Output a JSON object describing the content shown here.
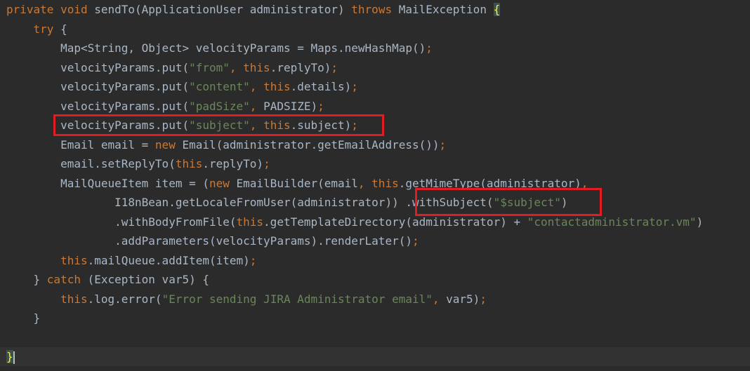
{
  "code": {
    "lines": [
      [
        {
          "t": "private void ",
          "c": "kw"
        },
        {
          "t": "sendTo(ApplicationUser administrator) ",
          "c": "plain"
        },
        {
          "t": "throws ",
          "c": "kw"
        },
        {
          "t": "MailException ",
          "c": "plain"
        },
        {
          "t": "{",
          "c": "brace-match"
        }
      ],
      [
        {
          "t": "    try ",
          "c": "kw"
        },
        {
          "t": "{",
          "c": "plain"
        }
      ],
      [
        {
          "t": "        Map<String, Object> velocityParams = Maps.newHashMap()",
          "c": "plain"
        },
        {
          "t": ";",
          "c": "kw"
        }
      ],
      [
        {
          "t": "        velocityParams.put(",
          "c": "plain"
        },
        {
          "t": "\"from\"",
          "c": "str"
        },
        {
          "t": ", ",
          "c": "kw"
        },
        {
          "t": "this",
          "c": "kw"
        },
        {
          "t": ".replyTo)",
          "c": "plain"
        },
        {
          "t": ";",
          "c": "kw"
        }
      ],
      [
        {
          "t": "        velocityParams.put(",
          "c": "plain"
        },
        {
          "t": "\"content\"",
          "c": "str"
        },
        {
          "t": ", ",
          "c": "kw"
        },
        {
          "t": "this",
          "c": "kw"
        },
        {
          "t": ".details)",
          "c": "plain"
        },
        {
          "t": ";",
          "c": "kw"
        }
      ],
      [
        {
          "t": "        velocityParams.put(",
          "c": "plain"
        },
        {
          "t": "\"padSize\"",
          "c": "str"
        },
        {
          "t": ", ",
          "c": "kw"
        },
        {
          "t": "PADSIZE)",
          "c": "plain"
        },
        {
          "t": ";",
          "c": "kw"
        }
      ],
      [
        {
          "t": "        velocityParams.put(",
          "c": "plain"
        },
        {
          "t": "\"subject\"",
          "c": "str"
        },
        {
          "t": ", ",
          "c": "kw"
        },
        {
          "t": "this",
          "c": "kw"
        },
        {
          "t": ".subject)",
          "c": "plain"
        },
        {
          "t": ";",
          "c": "kw"
        }
      ],
      [
        {
          "t": "        Email email = ",
          "c": "plain"
        },
        {
          "t": "new ",
          "c": "kw"
        },
        {
          "t": "Email(administrator.getEmailAddress())",
          "c": "plain"
        },
        {
          "t": ";",
          "c": "kw"
        }
      ],
      [
        {
          "t": "        email.setReplyTo(",
          "c": "plain"
        },
        {
          "t": "this",
          "c": "kw"
        },
        {
          "t": ".replyTo)",
          "c": "plain"
        },
        {
          "t": ";",
          "c": "kw"
        }
      ],
      [
        {
          "t": "        MailQueueItem item = (",
          "c": "plain"
        },
        {
          "t": "new ",
          "c": "kw"
        },
        {
          "t": "EmailBuilder(email",
          "c": "plain"
        },
        {
          "t": ", ",
          "c": "kw"
        },
        {
          "t": "this",
          "c": "kw"
        },
        {
          "t": ".getMimeType(administrator)",
          "c": "plain"
        },
        {
          "t": ",",
          "c": "kw"
        }
      ],
      [
        {
          "t": "                I18nBean.getLocaleFromUser(administrator)) .withSubject(",
          "c": "plain"
        },
        {
          "t": "\"$subject\"",
          "c": "str"
        },
        {
          "t": ")",
          "c": "plain"
        }
      ],
      [
        {
          "t": "                .withBodyFromFile(",
          "c": "plain"
        },
        {
          "t": "this",
          "c": "kw"
        },
        {
          "t": ".getTemplateDirectory(administrator) + ",
          "c": "plain"
        },
        {
          "t": "\"contactadministrator.vm\"",
          "c": "str"
        },
        {
          "t": ")",
          "c": "plain"
        }
      ],
      [
        {
          "t": "                .addParameters(velocityParams).renderLater()",
          "c": "plain"
        },
        {
          "t": ";",
          "c": "kw"
        }
      ],
      [
        {
          "t": "        ",
          "c": "plain"
        },
        {
          "t": "this",
          "c": "kw"
        },
        {
          "t": ".mailQueue.addItem(item)",
          "c": "plain"
        },
        {
          "t": ";",
          "c": "kw"
        }
      ],
      [
        {
          "t": "    } ",
          "c": "plain"
        },
        {
          "t": "catch ",
          "c": "kw"
        },
        {
          "t": "(Exception var5) {",
          "c": "plain"
        }
      ],
      [
        {
          "t": "        ",
          "c": "plain"
        },
        {
          "t": "this",
          "c": "kw"
        },
        {
          "t": ".log.error(",
          "c": "plain"
        },
        {
          "t": "\"Error sending JIRA Administrator email\"",
          "c": "str"
        },
        {
          "t": ", ",
          "c": "kw"
        },
        {
          "t": "var5)",
          "c": "plain"
        },
        {
          "t": ";",
          "c": "kw"
        }
      ],
      [
        {
          "t": "    }",
          "c": "plain"
        }
      ],
      [],
      [
        {
          "t": "}",
          "c": "brace-match"
        }
      ]
    ]
  },
  "annotations": [
    {
      "label": "velocityParams.put(\"subject\", this.subject);"
    },
    {
      "label": ".withSubject(\"$subject\")"
    }
  ],
  "colors": {
    "background": "#2b2b2b",
    "keyword": "#cc7832",
    "string": "#6a8759",
    "text": "#a9b7c6",
    "highlight_border": "#e31b23"
  }
}
